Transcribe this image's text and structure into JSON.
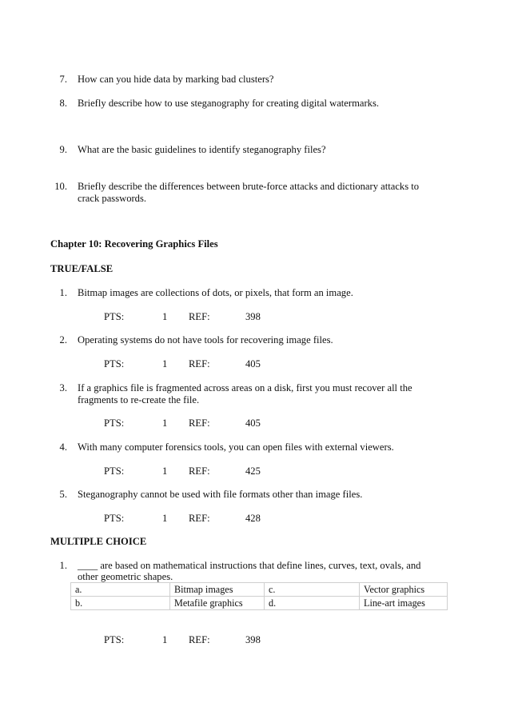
{
  "open_questions": [
    {
      "number": "7.",
      "text": "How can you hide data by marking bad clusters?"
    },
    {
      "number": "8.",
      "text": "Briefly describe how to use steganography for creating digital watermarks."
    },
    {
      "number": "9.",
      "text": "What are the basic guidelines to identify steganography files?"
    },
    {
      "number": "10.",
      "line1": "Briefly describe the differences between brute-force attacks and dictionary attacks to",
      "line2": "crack passwords."
    }
  ],
  "chapter_title": "Chapter 10: Recovering Graphics Files",
  "true_false": {
    "heading": "TRUE/FALSE",
    "pts_label": "PTS:",
    "ref_label": "REF:",
    "items": [
      {
        "number": "1.",
        "text": "Bitmap images are collections of dots, or pixels, that form an image.",
        "pts": "1",
        "ref": "398"
      },
      {
        "number": "2.",
        "text": "Operating systems do not have tools for recovering image files.",
        "pts": "1",
        "ref": "405"
      },
      {
        "number": "3.",
        "line1": "If a graphics file is fragmented across areas on a disk, first you must recover all the",
        "line2": "fragments to re-create the file.",
        "pts": "1",
        "ref": "405"
      },
      {
        "number": "4.",
        "text": "With many computer forensics tools, you can open files with external viewers.",
        "pts": "1",
        "ref": "425"
      },
      {
        "number": "5.",
        "text": "Steganography cannot be used with file formats other than image files.",
        "pts": "1",
        "ref": "428"
      }
    ]
  },
  "multiple_choice": {
    "heading": "MULTIPLE CHOICE",
    "items": [
      {
        "number": "1.",
        "line1": "____ are based on mathematical instructions that define lines, curves, text, ovals, and",
        "line2": "other geometric shapes.",
        "options": [
          {
            "letter": "a.",
            "text": "Bitmap images"
          },
          {
            "letter": "b.",
            "text": "Metafile graphics"
          },
          {
            "letter": "c.",
            "text": "Vector graphics"
          },
          {
            "letter": "d.",
            "text": "Line-art images"
          }
        ],
        "pts": "1",
        "ref": "398"
      }
    ]
  }
}
